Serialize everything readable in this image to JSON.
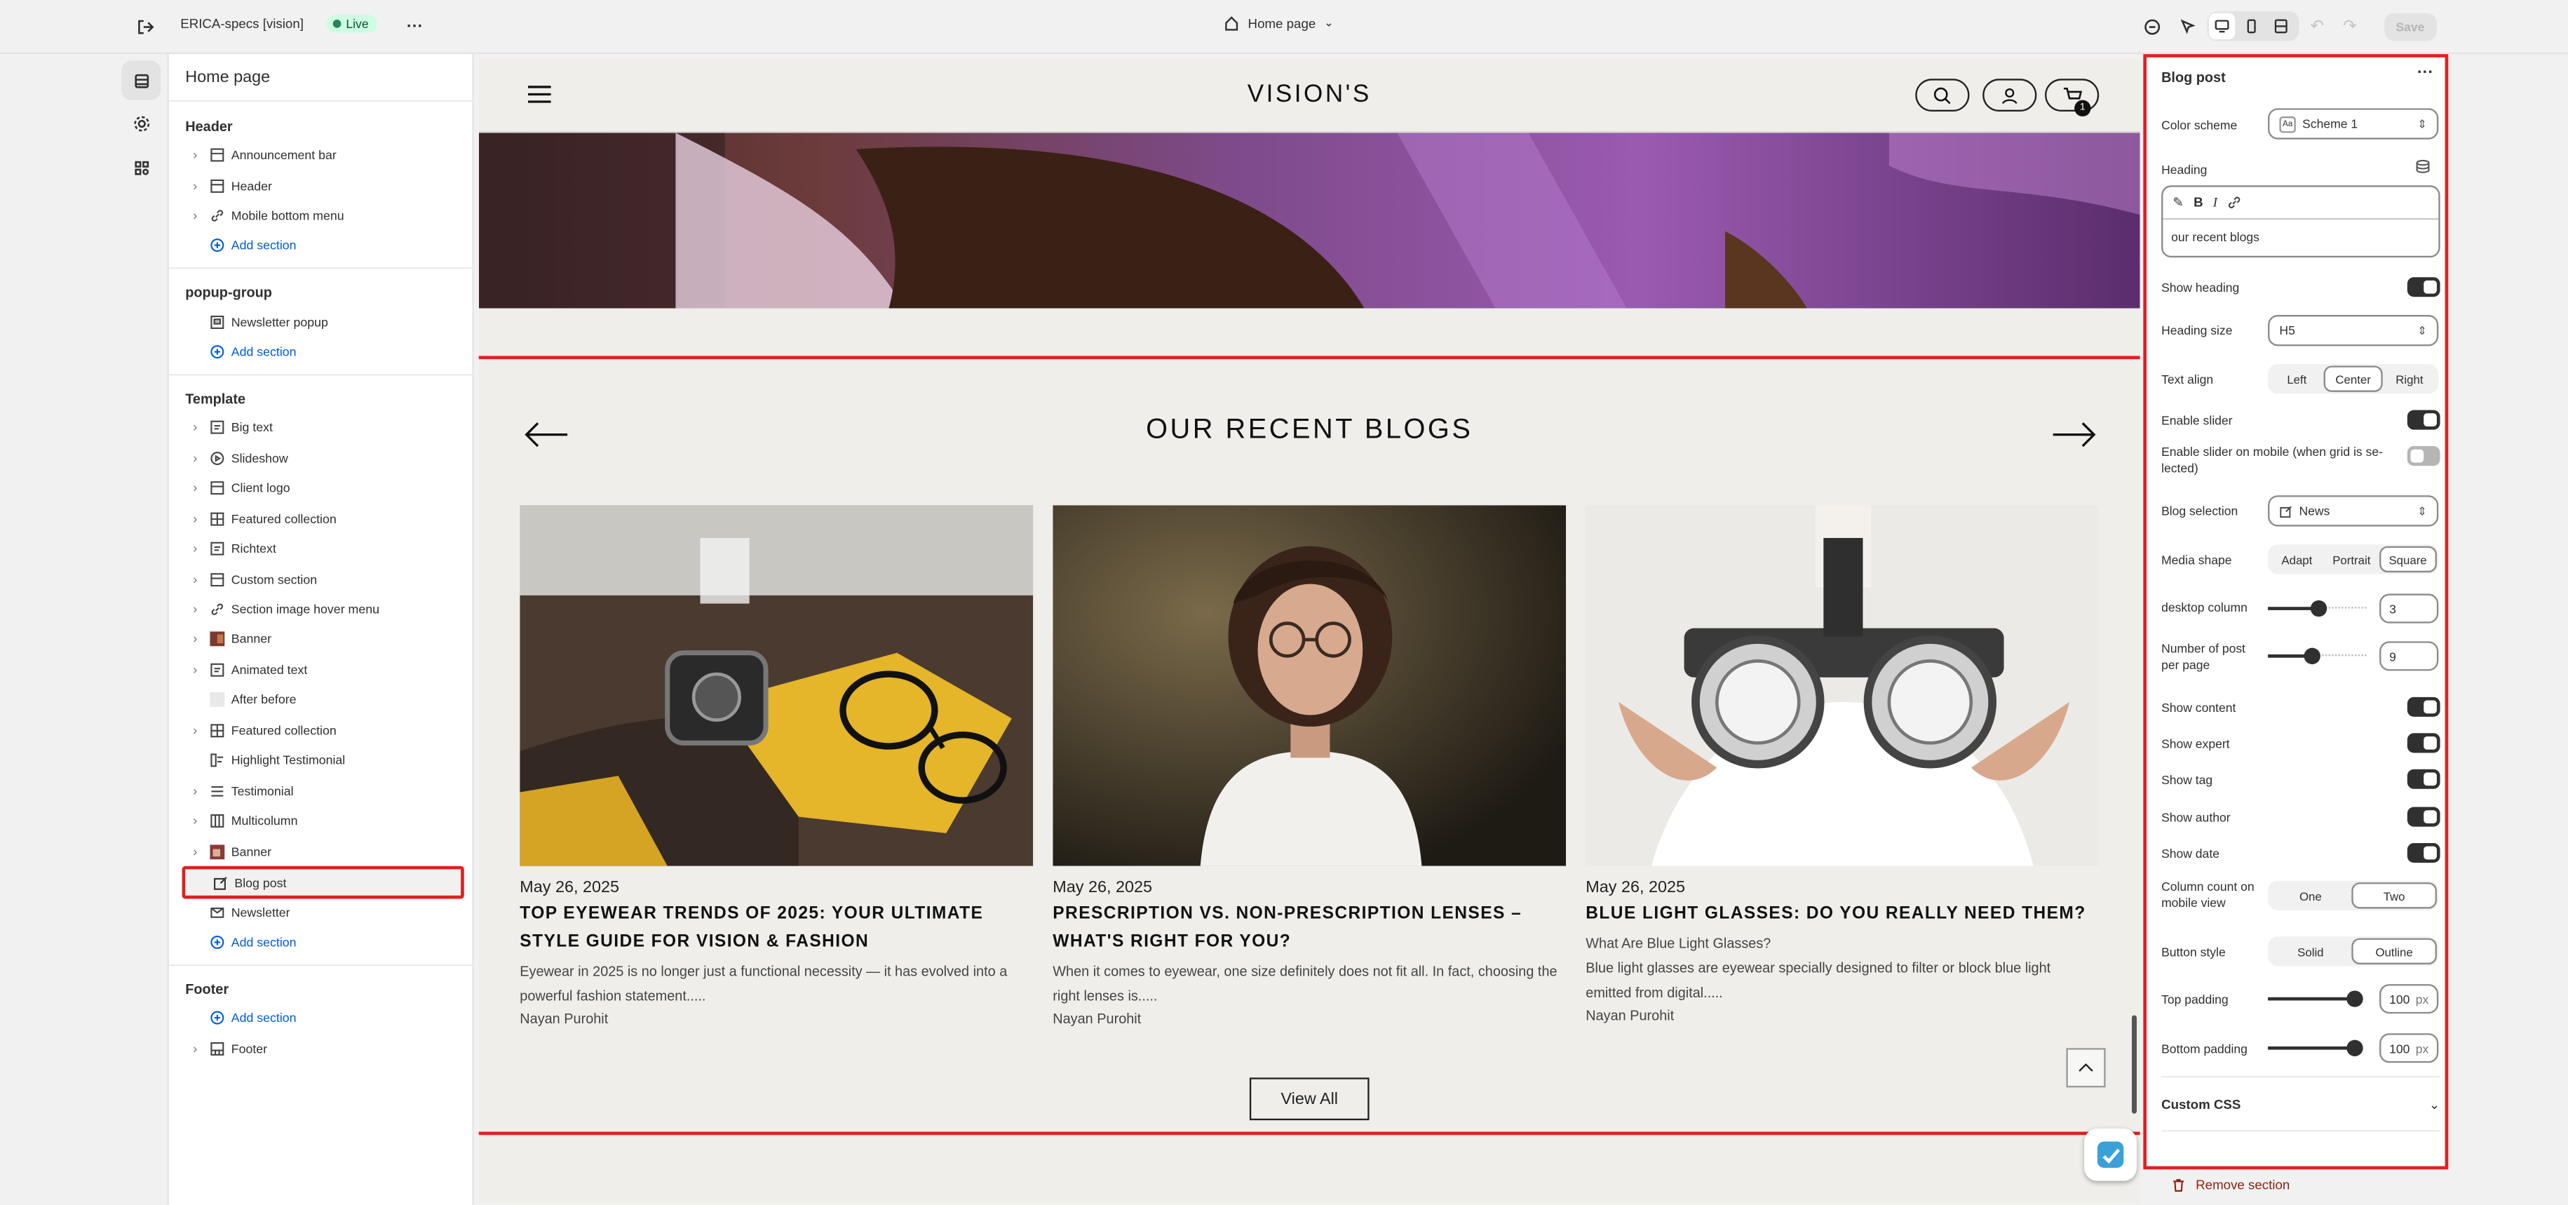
{
  "topbar": {
    "store_name": "ERICA-specs [vision]",
    "live_label": "Live",
    "page_selector": "Home page",
    "save_label": "Save"
  },
  "sidebar": {
    "title": "Home page",
    "groups": [
      {
        "title": "Header",
        "items": [
          "Announcement bar",
          "Header",
          "Mobile bottom menu"
        ],
        "add": "Add section"
      },
      {
        "title": "popup-group",
        "items": [
          "Newsletter popup"
        ],
        "add": "Add section"
      },
      {
        "title": "Template",
        "items": [
          "Big text",
          "Slideshow",
          "Client logo",
          "Featured collection",
          "Richtext",
          "Custom section",
          "Section image hover menu",
          "Banner",
          "Animated text",
          "After before",
          "Featured collection",
          "Highlight Testimonial",
          "Testimonial",
          "Multicolumn",
          "Banner",
          "Blog post",
          "Newsletter"
        ],
        "add": "Add section",
        "selected": "Blog post"
      },
      {
        "title": "Footer",
        "items": [
          "Footer"
        ],
        "add": "Add section"
      }
    ]
  },
  "preview": {
    "logo": "VISION'S",
    "cart_count": "1",
    "section_title": "OUR RECENT BLOGS",
    "view_all": "View All",
    "cards": [
      {
        "date": "May 26, 2025",
        "title": "TOP EYEWEAR TRENDS OF 2025: YOUR ULTIMATE STYLE GUIDE FOR VISION & FASHION",
        "excerpt": "Eyewear in 2025 is no longer just a functional necessity — it has evolved into a powerful fashion statement.....",
        "author": "Nayan Purohit"
      },
      {
        "date": "May 26, 2025",
        "title": "PRESCRIPTION VS. NON-PRESCRIPTION LENSES – WHAT'S RIGHT FOR YOU?",
        "excerpt": "When it comes to eyewear, one size definitely does not fit all. In fact, choosing the right lenses is.....",
        "author": "Nayan Purohit"
      },
      {
        "date": "May 26, 2025",
        "title": "BLUE LIGHT GLASSES: DO YOU REALLY NEED THEM?",
        "excerpt": "What Are Blue Light Glasses?\nBlue light glasses are eyewear specially designed to filter or block blue light emitted from digital.....",
        "author": "Nayan Purohit"
      }
    ]
  },
  "settings": {
    "title": "Blog post",
    "color_scheme_label": "Color scheme",
    "color_scheme_value": "Scheme 1",
    "heading_label": "Heading",
    "heading_value": "our recent blogs",
    "show_heading_label": "Show heading",
    "show_heading": true,
    "heading_size_label": "Heading size",
    "heading_size_value": "H5",
    "text_align_label": "Text align",
    "text_align_options": [
      "Left",
      "Center",
      "Right"
    ],
    "text_align_value": "Center",
    "enable_slider_label": "Enable slider",
    "enable_slider": true,
    "enable_slider_mobile_label": "Enable slider on mobile (when grid is se-lected)",
    "enable_slider_mobile": false,
    "blog_selection_label": "Blog selection",
    "blog_selection_value": "News",
    "media_shape_label": "Media shape",
    "media_shape_options": [
      "Adapt",
      "Portrait",
      "Square"
    ],
    "media_shape_value": "Square",
    "desktop_column_label": "desktop column",
    "desktop_column_value": "3",
    "desktop_column_fraction": 0.5,
    "posts_per_page_label": "Number of post per page",
    "posts_per_page_value": "9",
    "posts_per_page_fraction": 0.44,
    "toggles": [
      {
        "label": "Show content",
        "on": true
      },
      {
        "label": "Show expert",
        "on": true
      },
      {
        "label": "Show tag",
        "on": true
      },
      {
        "label": "Show author",
        "on": true
      },
      {
        "label": "Show date",
        "on": true
      }
    ],
    "column_count_label": "Column count on mobile view",
    "column_count_options": [
      "One",
      "Two"
    ],
    "column_count_value": "Two",
    "button_style_label": "Button style",
    "button_style_options": [
      "Solid",
      "Outline"
    ],
    "button_style_value": "Outline",
    "top_padding_label": "Top padding",
    "top_padding_value": "100",
    "bottom_padding_label": "Bottom padding",
    "bottom_padding_value": "100",
    "padding_unit": "px",
    "custom_css_label": "Custom CSS",
    "remove_label": "Remove section"
  },
  "colors": {
    "accent_red": "#e02020",
    "link_blue": "#005bd3",
    "live_green": "#29845a"
  }
}
